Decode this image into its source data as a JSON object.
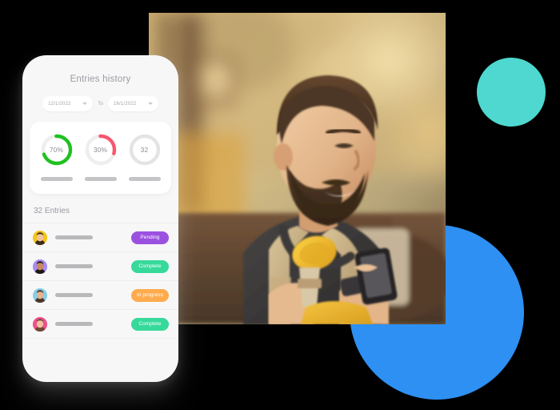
{
  "background_color": "#000000",
  "decor": {
    "teal_circle": {
      "name": "teal-circle",
      "color": "#4ed8cf"
    },
    "blue_circle": {
      "name": "blue-circle",
      "color": "#2e90f2"
    }
  },
  "photo": {
    "name": "hero-photo",
    "alt": "Smiling bearded man in overalls with yellow headphones around his neck, holding a coffee cup and looking at a smartphone outdoors"
  },
  "phone": {
    "title": "Entries history",
    "date_range": {
      "from_value": "12/1/2022",
      "to_label": "To",
      "to_value": "16/1/2022",
      "caret_icon": "chevron-down-icon"
    },
    "stats": [
      {
        "id": "completion-rate",
        "label": "70%",
        "value": 70,
        "color": "#1fc11f",
        "track": "#eeeeef",
        "has_arc": true
      },
      {
        "id": "pending-rate",
        "label": "30%",
        "value": 30,
        "color": "#f9566f",
        "track": "#eeeeef",
        "has_arc": true
      },
      {
        "id": "total-entries",
        "label": "32",
        "value": 0,
        "color": "#e4e4e6",
        "track": "#e4e4e6",
        "has_arc": false
      }
    ],
    "entries_header": "32 Entries",
    "entries": [
      {
        "avatar_bg": "#f5c518",
        "avatar_skin": "#f0c3a0",
        "avatar_hair": "#3a2a1d",
        "status": "Pending",
        "status_color": "#9b51e0"
      },
      {
        "avatar_bg": "#a78bf0",
        "avatar_skin": "#c98a62",
        "avatar_hair": "#201712",
        "status": "Complete",
        "status_color": "#37d99a"
      },
      {
        "avatar_bg": "#87cfe8",
        "avatar_skin": "#e8b48d",
        "avatar_hair": "#4a3528",
        "status": "In progress",
        "status_color": "#ffab4d"
      },
      {
        "avatar_bg": "#f0508c",
        "avatar_skin": "#f2c1a4",
        "avatar_hair": "#6b4a33",
        "status": "Complete",
        "status_color": "#37d99a"
      }
    ]
  }
}
